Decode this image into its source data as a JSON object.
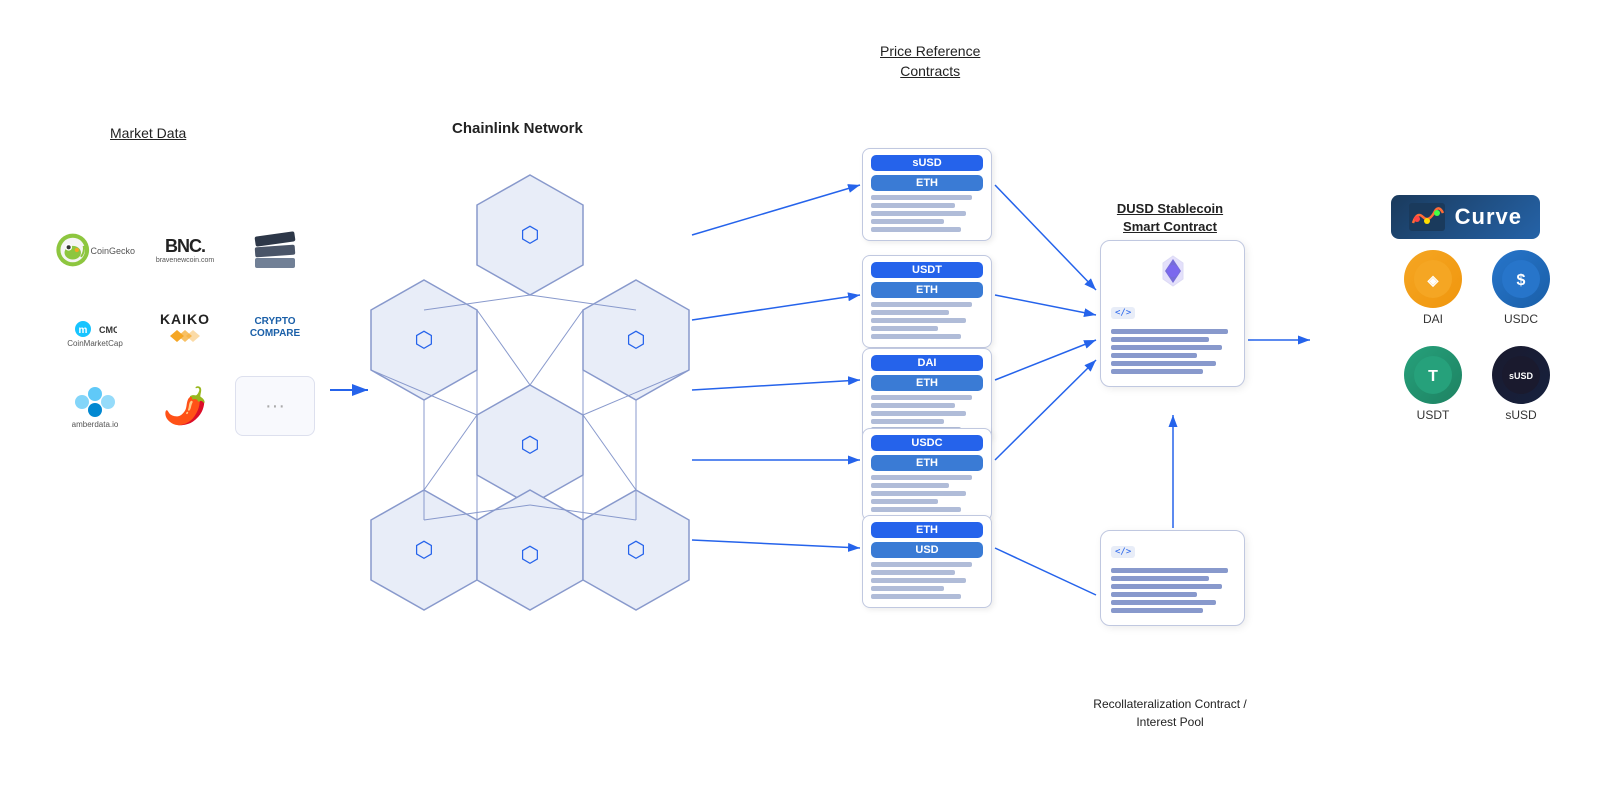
{
  "labels": {
    "market_data": "Market Data",
    "chainlink_network": "Chainlink Network",
    "price_ref_contracts": "Price Reference\nContracts",
    "dusd_smart_contract": "DUSD Stablecoin\nSmart Contract",
    "recoll_contract": "Recollateralization Contract /\nInterest Pool",
    "curve": "Curve"
  },
  "contracts": [
    {
      "badge1": "sUSD",
      "badge2": "ETH",
      "id": "susd-eth"
    },
    {
      "badge1": "USDT",
      "badge2": "ETH",
      "id": "usdt-eth"
    },
    {
      "badge1": "DAI",
      "badge2": "ETH",
      "id": "dai-eth"
    },
    {
      "badge1": "USDC",
      "badge2": "ETH",
      "id": "usdc-eth"
    },
    {
      "badge1": "ETH",
      "badge2": "USD",
      "id": "eth-usd"
    }
  ],
  "tokens": [
    {
      "label": "DAI",
      "color": "#f5a623",
      "symbol": "DAI"
    },
    {
      "label": "USDC",
      "color": "#2775ca",
      "symbol": "$"
    },
    {
      "label": "USDT",
      "color": "#26a17b",
      "symbol": "T"
    },
    {
      "label": "sUSD",
      "color": "#1a1a2e",
      "symbol": "sUSD"
    }
  ],
  "colors": {
    "chainlink_blue": "#2563eb",
    "arrow_color": "#2563eb",
    "card_border": "#c0c8e0",
    "hex_fill": "#e8edf8",
    "hex_stroke": "#8899cc"
  }
}
